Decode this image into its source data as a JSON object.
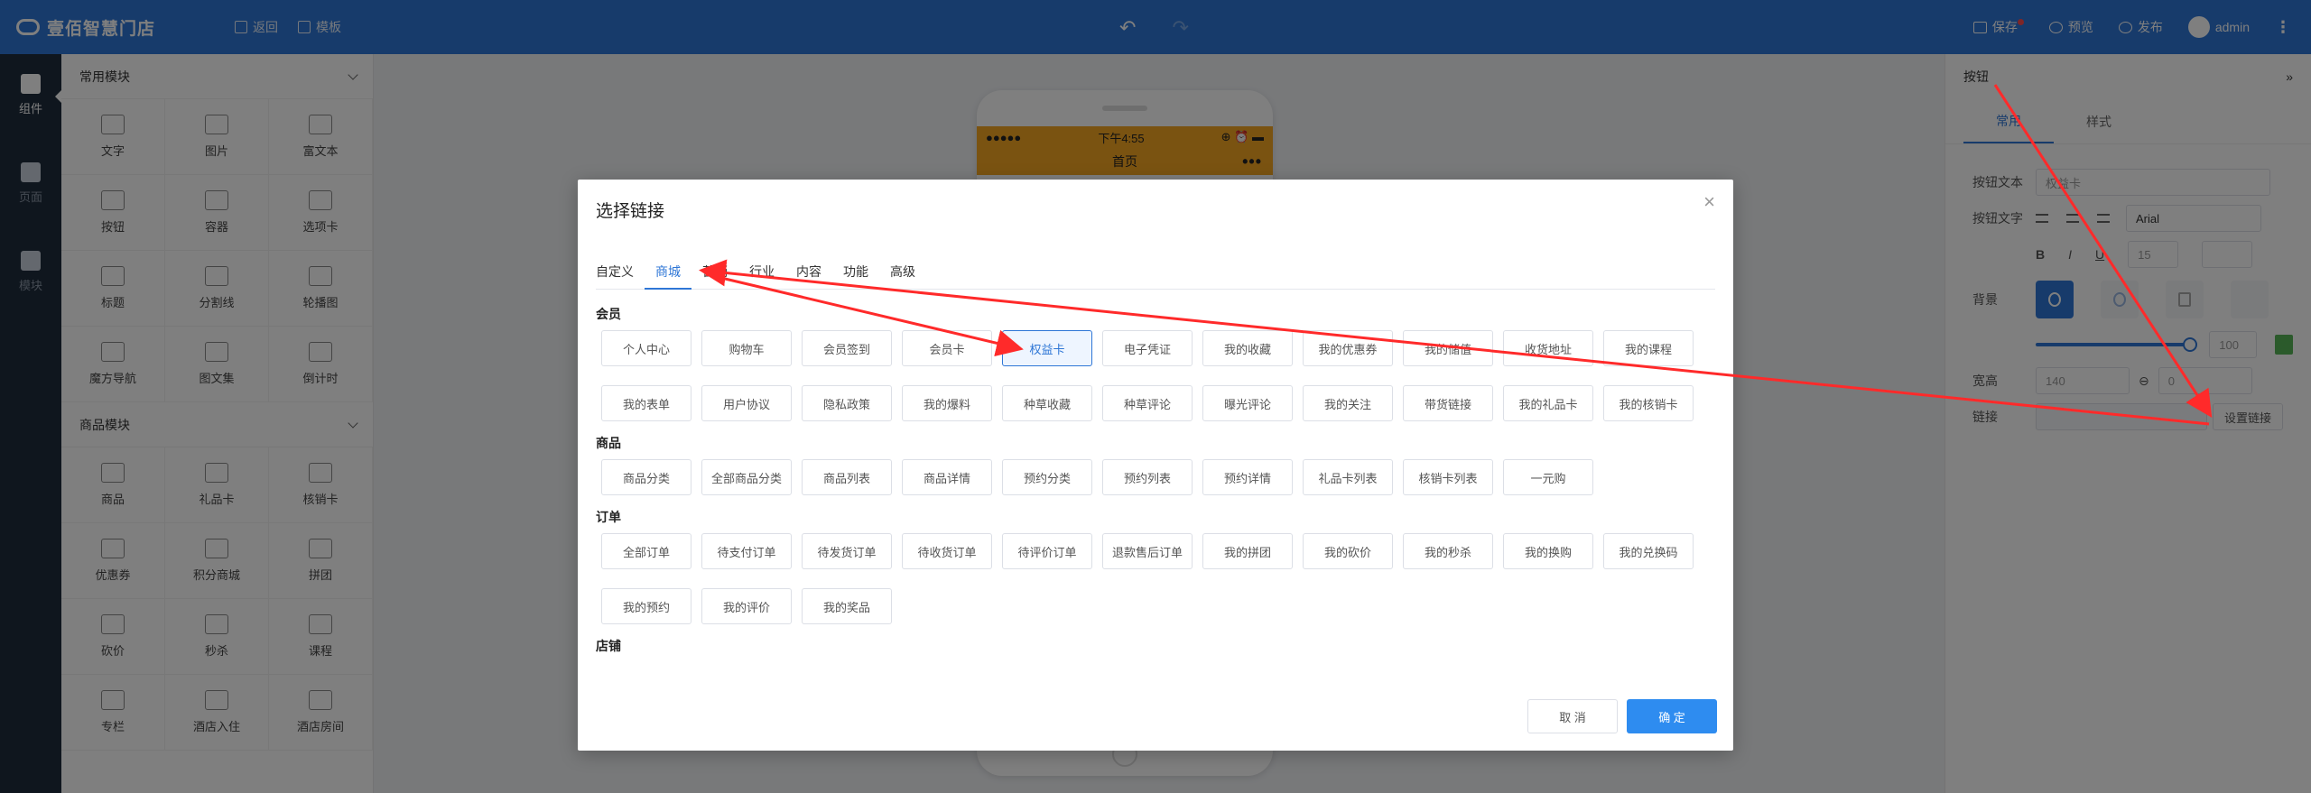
{
  "topbar": {
    "brand": "壹佰智慧门店",
    "back_label": "返回",
    "template_label": "模板",
    "undo_glyph": "↶",
    "redo_glyph": "↷",
    "save_label": "保存",
    "preview_label": "预览",
    "publish_label": "发布",
    "user_name": "admin",
    "more_glyph": "⋮"
  },
  "rail": {
    "items": [
      {
        "label": "组件",
        "active": true
      },
      {
        "label": "页面",
        "active": false
      },
      {
        "label": "模块",
        "active": false
      }
    ]
  },
  "components": {
    "common_title": "常用模块",
    "common_items": [
      "文字",
      "图片",
      "富文本",
      "按钮",
      "容器",
      "选项卡",
      "标题",
      "分割线",
      "轮播图",
      "魔方导航",
      "图文集",
      "倒计时"
    ],
    "goods_title": "商品模块",
    "goods_items": [
      "商品",
      "礼品卡",
      "核销卡",
      "优惠券",
      "积分商城",
      "拼团",
      "砍价",
      "秒杀",
      "课程",
      "专栏",
      "酒店入住",
      "酒店房间"
    ]
  },
  "phone": {
    "signal": "●●●●●",
    "time": "下午4:55",
    "battery": "⊕ ⏰ ▬",
    "page_title": "首页",
    "more": "•••"
  },
  "props": {
    "title": "按钮",
    "collapse_glyph": "»",
    "tabs": [
      "常用",
      "样式"
    ],
    "button_text_label": "按钮文本",
    "button_text_value": "权益卡",
    "button_font_label": "按钮文字",
    "font_value": "Arial",
    "font_size": "15",
    "bold_glyph": "B",
    "italic_glyph": "I",
    "underline_glyph": "U",
    "background_label": "背景",
    "opacity_value": "100",
    "size_label": "宽高",
    "width_value": "140",
    "height_value": "0",
    "link_label": "链接",
    "set_link_label": "设置链接"
  },
  "modal": {
    "title": "选择链接",
    "close_glyph": "×",
    "tabs": [
      "自定义",
      "商城",
      "营销",
      "行业",
      "内容",
      "功能",
      "高级"
    ],
    "active_tab": "商城",
    "sections": [
      {
        "title": "会员",
        "rows": [
          [
            "个人中心",
            "购物车",
            "会员签到",
            "会员卡",
            "权益卡",
            "电子凭证",
            "我的收藏",
            "我的优惠券",
            "我的储值",
            "收货地址",
            "我的课程"
          ],
          [
            "我的表单",
            "用户协议",
            "隐私政策",
            "我的爆料",
            "种草收藏",
            "种草评论",
            "曝光评论",
            "我的关注",
            "带货链接",
            "我的礼品卡",
            "我的核销卡"
          ]
        ]
      },
      {
        "title": "商品",
        "rows": [
          [
            "商品分类",
            "全部商品分类",
            "商品列表",
            "商品详情",
            "预约分类",
            "预约列表",
            "预约详情",
            "礼品卡列表",
            "核销卡列表",
            "一元购"
          ]
        ]
      },
      {
        "title": "订单",
        "rows": [
          [
            "全部订单",
            "待支付订单",
            "待发货订单",
            "待收货订单",
            "待评价订单",
            "退款售后订单",
            "我的拼团",
            "我的砍价",
            "我的秒杀",
            "我的换购",
            "我的兑换码"
          ],
          [
            "我的预约",
            "我的评价",
            "我的奖品"
          ]
        ]
      },
      {
        "title": "店铺",
        "rows": []
      }
    ],
    "selected_link": "权益卡",
    "cancel_label": "取 消",
    "ok_label": "确 定"
  },
  "colors": {
    "primary": "#2e76d6",
    "annotation_arrow": "#ff2a2a",
    "phone_header": "#f5a623"
  }
}
